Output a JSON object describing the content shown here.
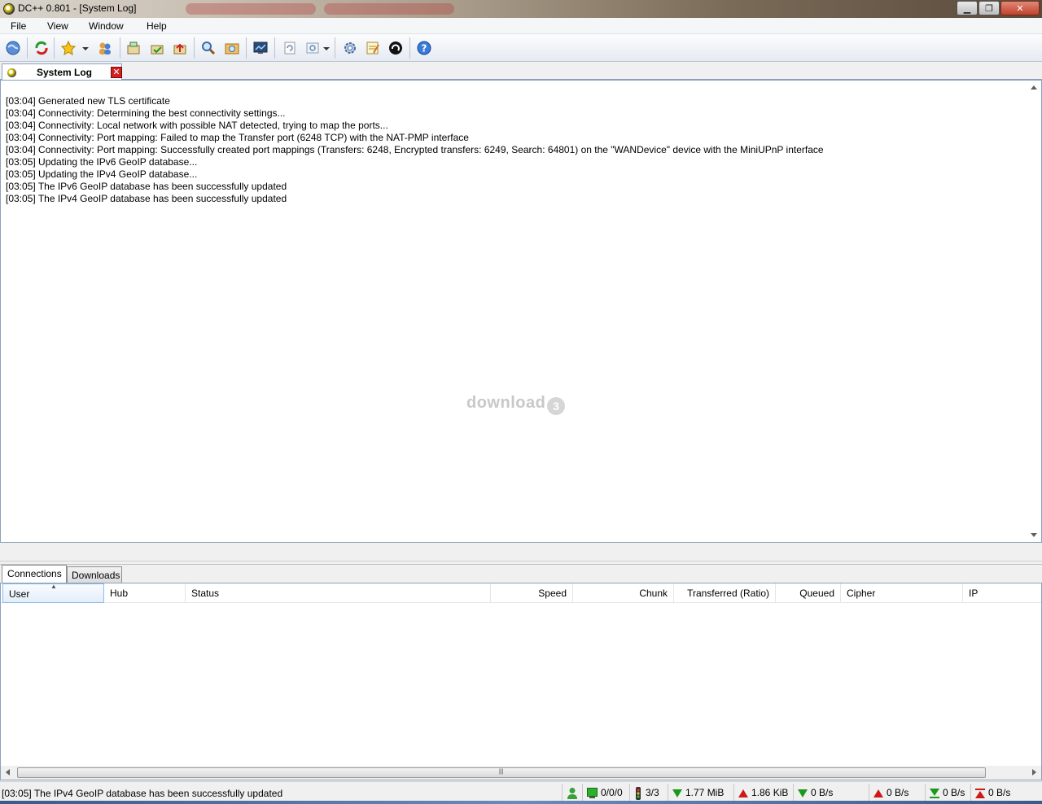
{
  "window": {
    "title": "DC++ 0.801 - [System Log]"
  },
  "menu": [
    "File",
    "View",
    "Window",
    "Help"
  ],
  "toolbar": {
    "icons": [
      "public-hubs-icon",
      "reconnect-icon",
      "favorite-hubs-icon",
      "favorite-users-icon",
      "download-queue-icon",
      "finished-downloads-icon",
      "finished-uploads-icon",
      "search-icon",
      "adl-search-icon",
      "notepad-monitor-icon",
      "refresh-file-list-icon",
      "open-file-list-icon",
      "settings-icon",
      "notepad-icon",
      "away-icon",
      "help-icon"
    ]
  },
  "tabs": {
    "active": "System Log"
  },
  "log": {
    "lines": [
      "[03:04] Generated new TLS certificate",
      "[03:04] Connectivity: Determining the best connectivity settings...",
      "[03:04] Connectivity: Local network with possible NAT detected, trying to map the ports...",
      "[03:04] Connectivity: Port mapping: Failed to map the Transfer port (6248 TCP) with the NAT-PMP interface",
      "[03:04] Connectivity: Port mapping: Successfully created port mappings (Transfers: 6248, Encrypted transfers: 6249, Search: 64801) on the \"WANDevice\" device with the MiniUPnP interface",
      "[03:05] Updating the IPv6 GeoIP database...",
      "[03:05] Updating the IPv4 GeoIP database...",
      "[03:05] The IPv6 GeoIP database has been successfully updated",
      "[03:05] The IPv4 GeoIP database has been successfully updated"
    ]
  },
  "watermark": "download",
  "bottom_tabs": [
    "Connections",
    "Downloads"
  ],
  "connections": {
    "columns": [
      "User",
      "Hub",
      "Status",
      "Speed",
      "Chunk",
      "Transferred (Ratio)",
      "Queued",
      "Cipher",
      "IP"
    ]
  },
  "status": {
    "message": "[03:05] The IPv4 GeoIP database has been successfully updated",
    "hubs": "0/0/0",
    "slots": "3/3",
    "downloaded": "1.77 MiB",
    "uploaded": "1.86 KiB",
    "down_speed": "0 B/s",
    "up_speed": "0 B/s",
    "down_limit": "0 B/s",
    "up_limit": "0 B/s"
  }
}
